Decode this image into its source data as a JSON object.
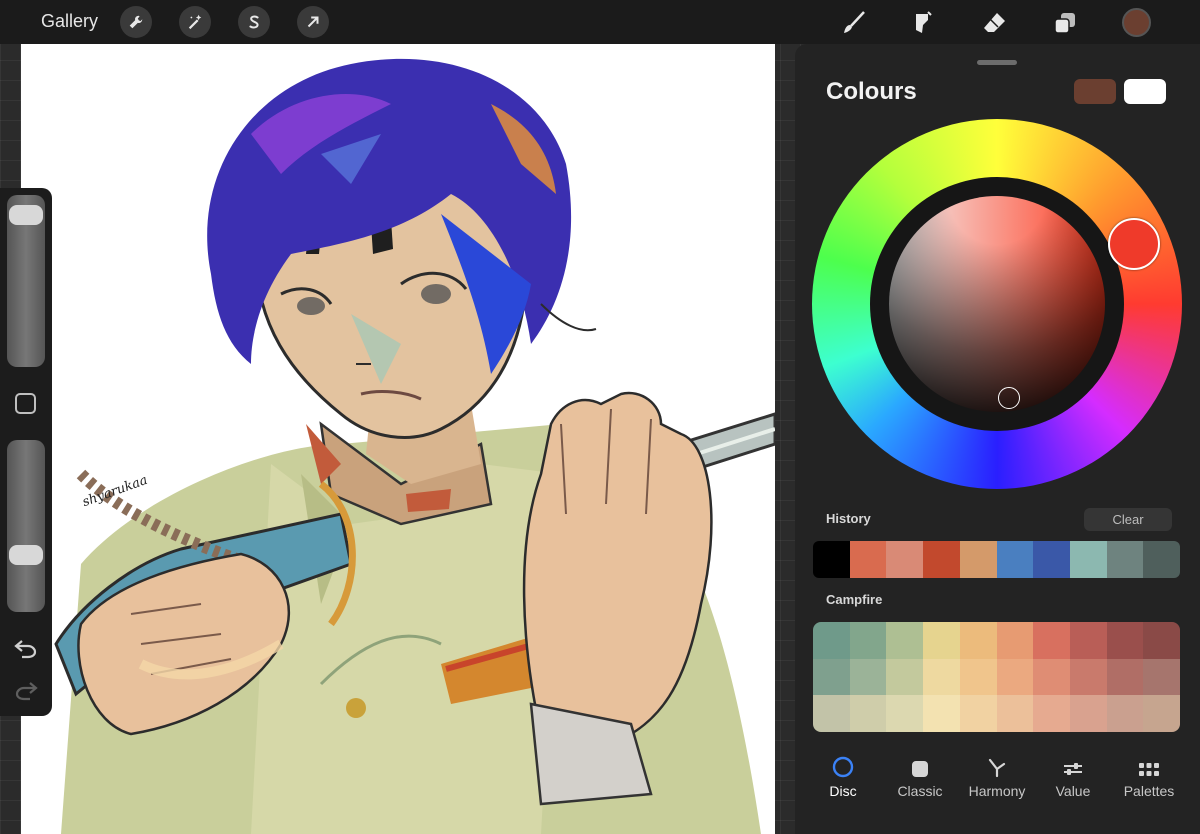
{
  "topbar": {
    "gallery_label": "Gallery",
    "actions": [
      "wrench-icon",
      "magic-wand-icon",
      "selection-s-icon",
      "transform-arrow-icon"
    ],
    "tools": [
      "brush-icon",
      "smudge-icon",
      "eraser-icon",
      "layers-icon"
    ],
    "current_color": "#6b3f30"
  },
  "canvas": {
    "signature": "shyarukaa"
  },
  "sidebar": {
    "size_level": 0.95,
    "opacity_level": 0.3
  },
  "panel": {
    "title": "Colours",
    "primary_color": "#6b3f30",
    "secondary_color": "#ffffff",
    "history_label": "History",
    "clear_label": "Clear",
    "history": [
      "#000000",
      "#d96b4f",
      "#d98a76",
      "#c2492d",
      "#d49a6a",
      "#4a7fc0",
      "#3a58a8",
      "#8cb8b0",
      "#6e837f",
      "#4f5f5c"
    ],
    "palette_name": "Campfire",
    "palette": [
      [
        "#6f9a8a",
        "#82a68c",
        "#aebf93",
        "#e6d48f",
        "#ecbb7c",
        "#e79b72",
        "#d8705f",
        "#b95e57",
        "#9a4f4c",
        "#8a4a47"
      ],
      [
        "#7fa08e",
        "#9bb398",
        "#c3c99d",
        "#eed9a0",
        "#f0c58c",
        "#eba980",
        "#df8d74",
        "#c97a6c",
        "#b06e66",
        "#a6756d"
      ],
      [
        "#c2c3a8",
        "#cfcdaa",
        "#dcd8b0",
        "#f3e2b1",
        "#f1d2a2",
        "#ecc09a",
        "#e6aa90",
        "#d9a28f",
        "#caa08f",
        "#c6a58f"
      ]
    ],
    "tabs": [
      {
        "label": "Disc",
        "icon": "disc-icon",
        "active": true
      },
      {
        "label": "Classic",
        "icon": "square-icon",
        "active": false
      },
      {
        "label": "Harmony",
        "icon": "harmony-icon",
        "active": false
      },
      {
        "label": "Value",
        "icon": "sliders-icon",
        "active": false
      },
      {
        "label": "Palettes",
        "icon": "grid-icon",
        "active": false
      }
    ]
  },
  "colors": {
    "accent": "#3b82f6",
    "panel_bg": "#232323"
  }
}
